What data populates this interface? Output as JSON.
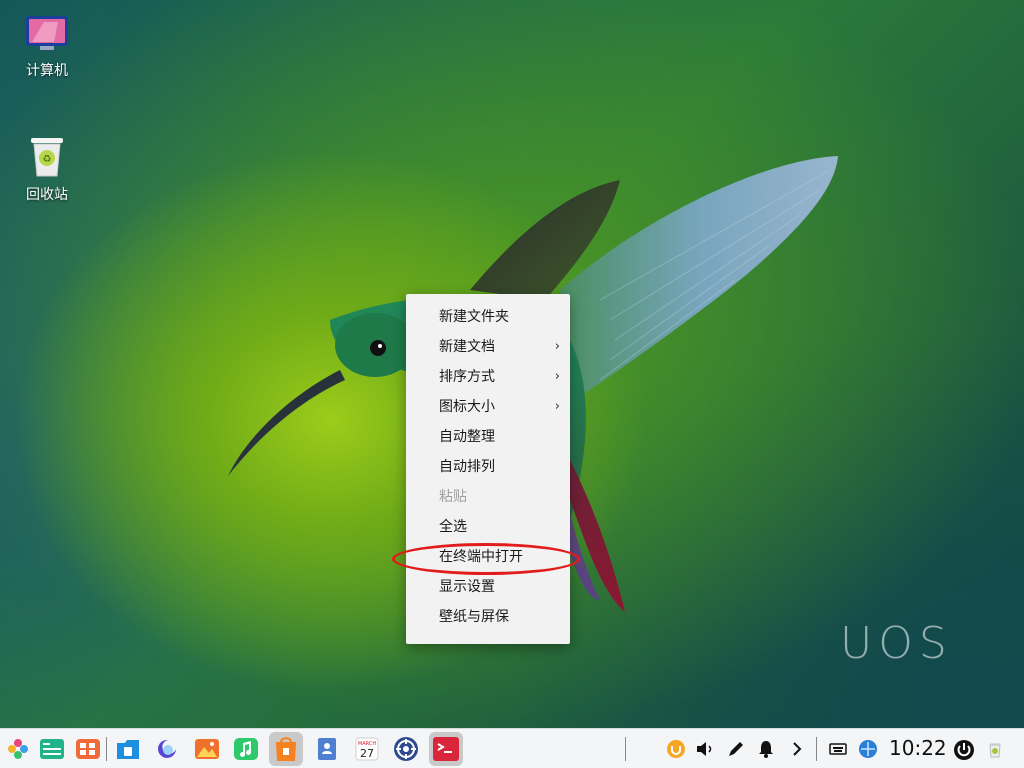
{
  "desktop": {
    "icons": [
      {
        "label": "计算机"
      },
      {
        "label": "回收站"
      }
    ],
    "watermark": "UOS"
  },
  "context_menu": {
    "items": [
      {
        "label": "新建文件夹",
        "submenu": false,
        "enabled": true
      },
      {
        "label": "新建文档",
        "submenu": true,
        "enabled": true
      },
      {
        "label": "排序方式",
        "submenu": true,
        "enabled": true
      },
      {
        "label": "图标大小",
        "submenu": true,
        "enabled": true
      },
      {
        "label": "自动整理",
        "submenu": false,
        "enabled": true
      },
      {
        "label": "自动排列",
        "submenu": false,
        "enabled": true
      },
      {
        "label": "粘贴",
        "submenu": false,
        "enabled": false
      },
      {
        "label": "全选",
        "submenu": false,
        "enabled": true
      },
      {
        "label": "在终端中打开",
        "submenu": false,
        "enabled": true,
        "highlighted": true
      },
      {
        "label": "显示设置",
        "submenu": false,
        "enabled": true
      },
      {
        "label": "壁纸与屏保",
        "submenu": false,
        "enabled": true
      }
    ],
    "submenu_glyph": "›",
    "highlight_color": "#e21b1b"
  },
  "taskbar": {
    "apps": [
      {
        "icon": "launcher-icon"
      },
      {
        "icon": "multitask-view-icon"
      },
      {
        "icon": "app-grid-icon"
      },
      {
        "icon": "file-manager-icon"
      },
      {
        "icon": "browser-icon"
      },
      {
        "icon": "photos-icon"
      },
      {
        "icon": "music-icon"
      },
      {
        "icon": "app-store-icon",
        "active": true
      },
      {
        "icon": "contacts-icon"
      },
      {
        "icon": "calendar-icon",
        "month": "MARCH",
        "day": "27"
      },
      {
        "icon": "settings-icon"
      },
      {
        "icon": "terminal-icon",
        "active": true
      }
    ],
    "tray": [
      "update-icon",
      "volume-icon",
      "pen-icon",
      "notification-icon",
      "chevron-right-icon",
      "keyboard-icon",
      "network-icon"
    ],
    "clock": "10:22",
    "power_icon": "power-icon",
    "trash_icon": "trash-tray-icon"
  }
}
